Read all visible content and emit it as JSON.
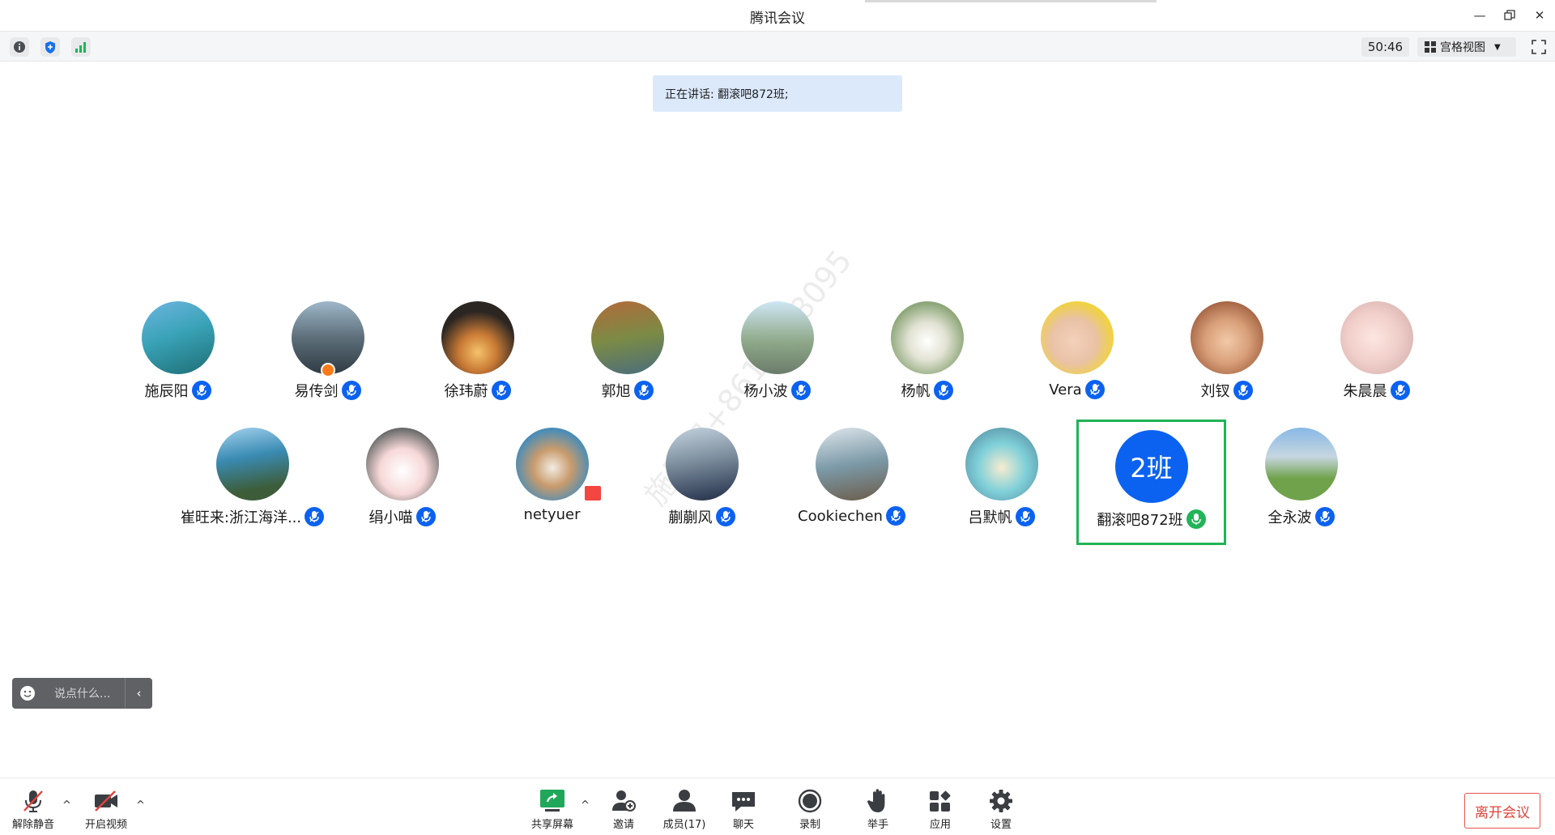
{
  "window": {
    "title": "腾讯会议",
    "controls": [
      "minimize-icon",
      "restore-icon",
      "close-icon"
    ]
  },
  "toolbar": {
    "icons": [
      "info-icon",
      "shield-icon",
      "signal-icon"
    ],
    "timer": "50:46",
    "view_label": "宫格视图",
    "fullscreen_icon": "fullscreen-icon"
  },
  "banner": {
    "speaking": "正在讲话: 翻滚吧872班;"
  },
  "participants": [
    {
      "name": "施辰阳",
      "mic": "blue"
    },
    {
      "name": "易传剑",
      "mic": "blue",
      "host": true
    },
    {
      "name": "徐玮蔚",
      "mic": "blue"
    },
    {
      "name": "郭旭",
      "mic": "blue"
    },
    {
      "name": "杨小波",
      "mic": "blue"
    },
    {
      "name": "杨帆",
      "mic": "blue"
    },
    {
      "name": "Vera",
      "mic": "blue"
    },
    {
      "name": "刘钗",
      "mic": "blue"
    },
    {
      "name": "朱晨晨",
      "mic": "blue"
    },
    {
      "name": "崔旺来:浙江海洋...",
      "mic": "blue"
    },
    {
      "name": "绢小喵",
      "mic": "blue"
    },
    {
      "name": "netyuer",
      "mic": "none"
    },
    {
      "name": "蒯蒯风",
      "mic": "blue"
    },
    {
      "name": "Cookiechen",
      "mic": "blue"
    },
    {
      "name": "吕默帆",
      "mic": "blue"
    },
    {
      "name": "翻滚吧872班",
      "mic": "green",
      "avatar_text": "2班",
      "active": true
    },
    {
      "name": "全永波",
      "mic": "blue"
    }
  ],
  "watermark": "施辰阳+8615168095",
  "chat": {
    "placeholder": "说点什么..."
  },
  "bottom": {
    "unmute": "解除静音",
    "start_video": "开启视频",
    "share_screen": "共享屏幕",
    "invite": "邀请",
    "members": "成员(17)",
    "chat": "聊天",
    "record": "录制",
    "raise_hand": "举手",
    "apps": "应用",
    "settings": "设置",
    "leave": "离开会议"
  },
  "colors": {
    "accent": "#0b62f0",
    "active_border": "#20b356",
    "leave": "#e0443c",
    "banner_bg": "#dbe9fb"
  }
}
